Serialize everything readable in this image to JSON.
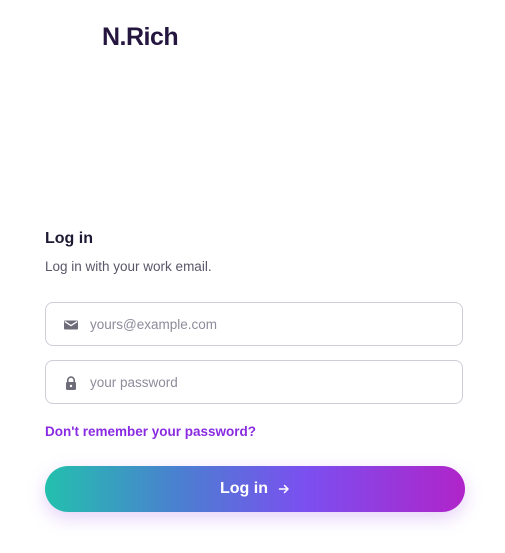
{
  "brand": {
    "name": "N.Rich",
    "logo_icon": "waveform-logo-icon",
    "text_color": "#25163f"
  },
  "login": {
    "title": "Log in",
    "subtitle": "Log in with your work email.",
    "email": {
      "icon": "mail-icon",
      "placeholder": "yours@example.com",
      "value": ""
    },
    "password": {
      "icon": "lock-icon",
      "placeholder": "your password",
      "value": ""
    },
    "forgot_link": "Don't remember your password?",
    "submit_label": "Log in",
    "submit_icon": "arrow-right-icon"
  },
  "colors": {
    "accent": "#8a2be2",
    "gradient_start": "#23c0ad",
    "gradient_end": "#b024c9",
    "field_border": "#cfcdd6"
  }
}
